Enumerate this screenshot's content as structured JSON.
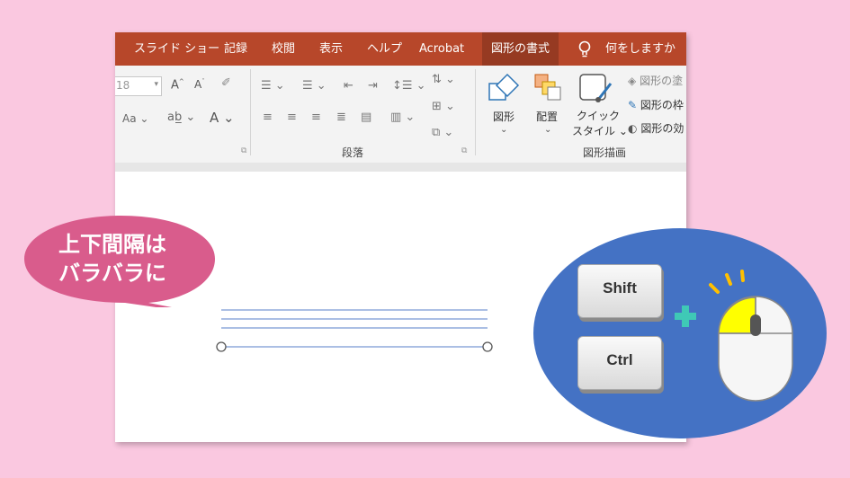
{
  "ribbon_tabs": [
    "スライド ショー",
    "記録",
    "校閲",
    "表示",
    "ヘルプ",
    "Acrobat",
    "図形の書式",
    "何をしますか"
  ],
  "active_tab": "図形の書式",
  "font_size_value": "18",
  "font_size_label": "Aa",
  "groups": {
    "paragraph": "段落",
    "drawing": "図形描画"
  },
  "drawing_buttons": {
    "shape": "図形",
    "arrange": "配置",
    "quick_style_line1": "クイック",
    "quick_style_line2": "スタイル",
    "fill": "図形の塗",
    "outline": "図形の枠",
    "effects": "図形の効"
  },
  "callout": {
    "line1": "上下間隔は",
    "line2": "バラバラに"
  },
  "keys": {
    "shift": "Shift",
    "ctrl": "Ctrl"
  },
  "colors": {
    "accent": "#b7472a",
    "background": "#fac8e0",
    "callout": "#d95c8c",
    "badge": "#4472c4",
    "plus": "#3fc9b6",
    "mouse_button": "#ffff00"
  }
}
